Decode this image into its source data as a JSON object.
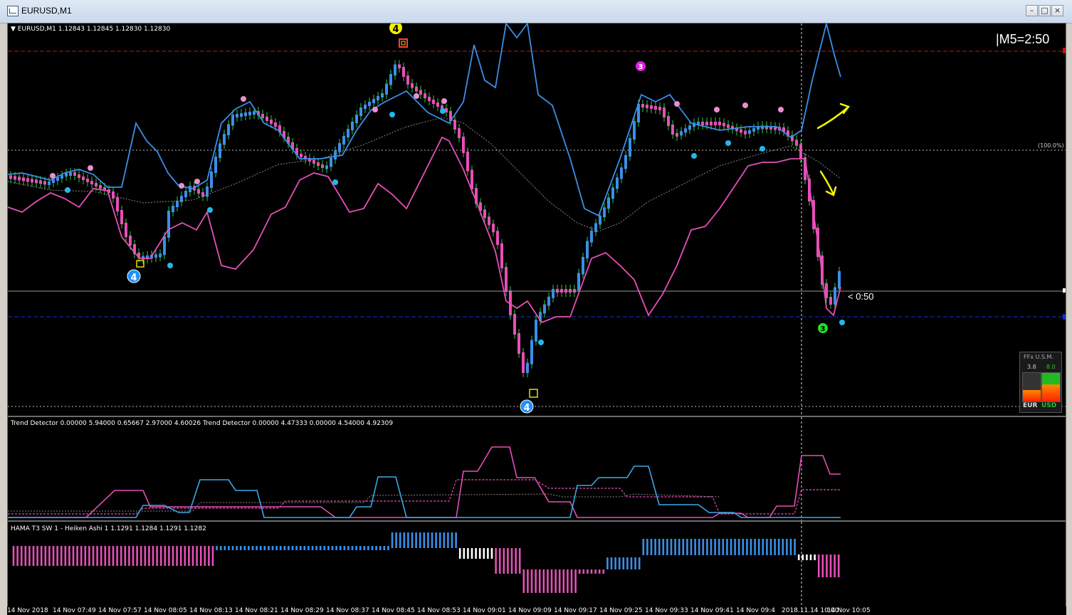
{
  "window": {
    "title": "EURUSD,M1"
  },
  "main_chart": {
    "header": "EURUSD,M1  1.12843 1.12845 1.12830 1.12830",
    "timer": "|M5=2:50",
    "candle_timer": "< 0:50",
    "fib_label": "(100.0%)",
    "markers": [
      "4",
      "4",
      "3",
      "4",
      "3"
    ],
    "widget": {
      "title": "FFx U.S.M.",
      "eur_value": "3.8",
      "usd_value": "8.0",
      "eur_label": "EUR",
      "usd_label": "USD"
    }
  },
  "trend_detector": {
    "header": "Trend Detector 0.00000 5.94000 0.65667 2.97000 4.60026  Trend Detector 0.00000 4.47333 0.00000 4.54000 4.92309"
  },
  "heiken_ashi": {
    "header": "HAMA T3 SW 1 -  Heiken Ashi 1 1.1291 1.1284 1.1291 1.1282"
  },
  "time_axis": [
    "14 Nov 2018",
    "14 Nov 07:49",
    "14 Nov 07:57",
    "14 Nov 08:05",
    "14 Nov 08:13",
    "14 Nov 08:21",
    "14 Nov 08:29",
    "14 Nov 08:37",
    "14 Nov 08:45",
    "14 Nov 08:53",
    "14 Nov 09:01",
    "14 Nov 09:09",
    "14 Nov 09:17",
    "14 Nov 09:25",
    "14 Nov 09:33",
    "14 Nov 09:41",
    "14 Nov 09:4",
    "2018.11.14 10:00",
    "14 Nov 10:05"
  ],
  "colors": {
    "bull": "#3b8fe8",
    "bear": "#e64fb7",
    "red_line": "#d01010",
    "blue_line": "#1030d0",
    "arrow": "#f5f500"
  }
}
